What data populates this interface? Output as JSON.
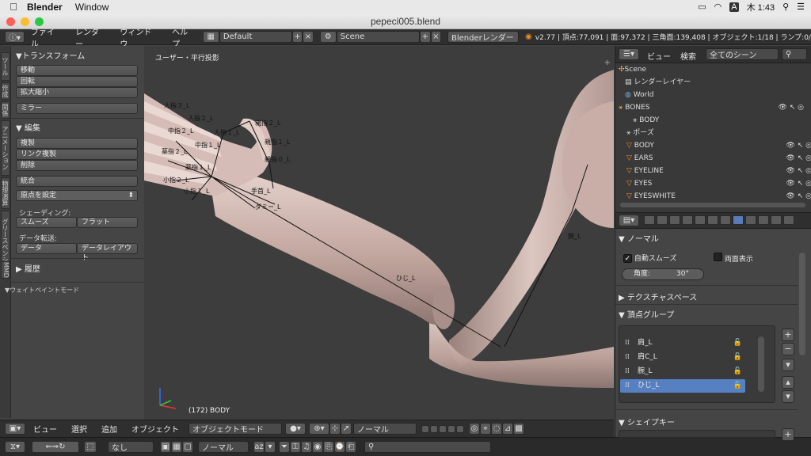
{
  "menubar": {
    "app_name": "Blender",
    "items": [
      "Window"
    ],
    "status_items": [
      "A",
      "木 1:43"
    ]
  },
  "window": {
    "title": "pepeci005.blend"
  },
  "infobar": {
    "menus": [
      "ファイル",
      "レンダー",
      "ウィンドウ",
      "ヘルプ"
    ],
    "layout": "Default",
    "scene": "Scene",
    "engine": "Blenderレンダー",
    "stats": "v2.77 | 頂点:77,091 | 面:97,372 | 三角面:139,408 | オブジェクト:1/18 | ランプ:0/"
  },
  "tabs": [
    "ツール",
    "作成",
    "関係",
    "アニメーション",
    "物理演算",
    "グリースペンシル",
    "MMD"
  ],
  "toolshelf": {
    "transform_header": "▼トランスフォーム",
    "transform": [
      "移動",
      "回転",
      "拡大縮小"
    ],
    "mirror": "ミラー",
    "edit_header": "▼ 編集",
    "edit": [
      "複製",
      "リンク複製",
      "削除"
    ],
    "join": "統合",
    "origin": "原点を設定",
    "shading_label": "シェーディング:",
    "smooth": "スムーズ",
    "flat": "フラット",
    "data_transfer_label": "データ転送:",
    "data": "データ",
    "data_layout": "データレイアウト",
    "history": "▶ 履歴",
    "weight_mode": "▼ウェイトペイントモード"
  },
  "viewport": {
    "view_label": "ユーザー・平行投影",
    "object_label": "(172) BODY",
    "bone_labels": [
      "人指３_L",
      "人指２_L",
      "親指２_L",
      "人指１_L",
      "中指２_L",
      "中指１_L",
      "親指１_L",
      "薬指２_L",
      "親指０_L",
      "薬指１_L",
      "小指２_L",
      "小指１_L",
      "手首_L",
      "ダミー_L",
      "ひじ_L",
      "腕_L"
    ]
  },
  "v3dheader": {
    "menus": [
      "ビュー",
      "選択",
      "追加",
      "オブジェクト"
    ],
    "mode": "オブジェクトモード",
    "orientation": "ノーマル"
  },
  "timeline": {
    "none_label": "なし",
    "normal_label": "ノーマル"
  },
  "outliner": {
    "view": "ビュー",
    "search": "検索",
    "filter": "全てのシーン",
    "rows": [
      "Scene",
      "レンダーレイヤー",
      "World",
      "BONES",
      "BODY",
      "ポーズ",
      "BODY",
      "EARS",
      "EYELINE",
      "EYES",
      "EYESWHITE"
    ]
  },
  "properties": {
    "normal_header": "▼ ノーマル",
    "auto_smooth": "自動スムーズ",
    "double_sided": "両面表示",
    "angle_label": "角度:",
    "angle_value": "30°",
    "texture_space": "▶ テクスチャスペース",
    "vertex_groups": "▼ 頂点グループ",
    "groups": [
      "肩_L",
      "肩C_L",
      "腕_L",
      "ひじ_L"
    ],
    "shape_keys": "▼ シェイプキー"
  }
}
